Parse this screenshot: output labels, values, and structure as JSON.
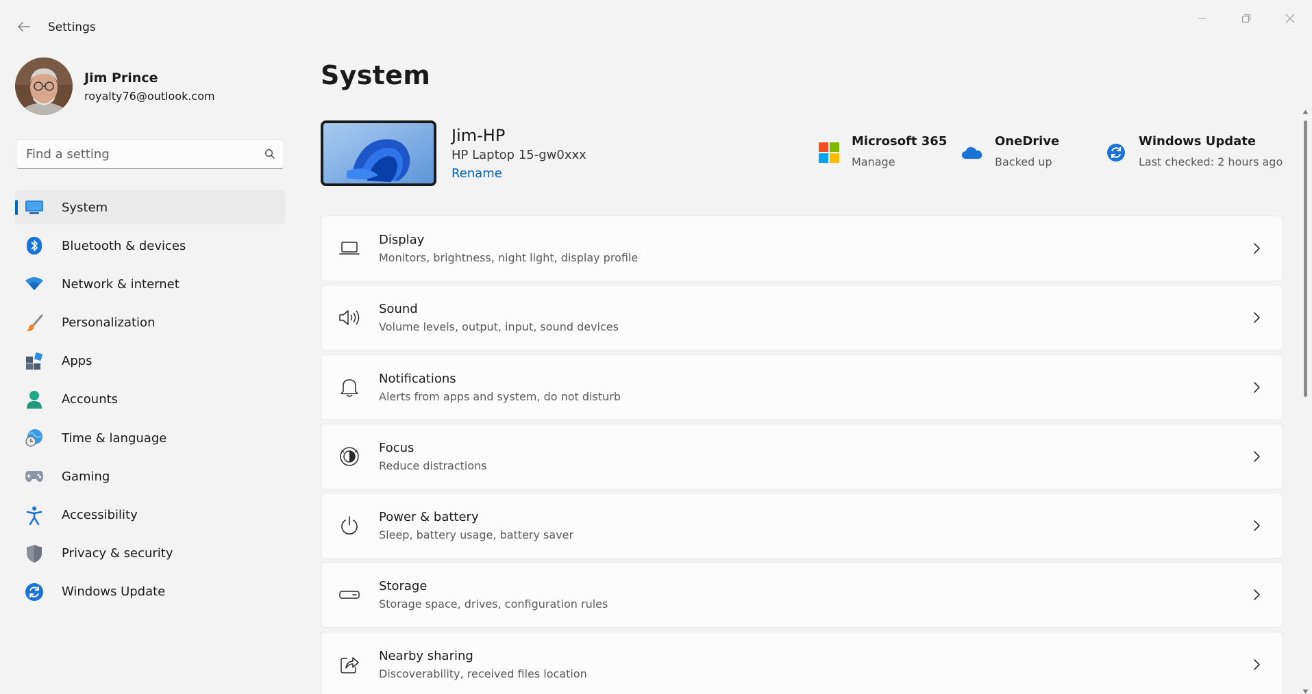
{
  "window": {
    "title": "Settings"
  },
  "profile": {
    "name": "Jim Prince",
    "email": "royalty76@outlook.com"
  },
  "search": {
    "placeholder": "Find a setting"
  },
  "sidebar": {
    "items": [
      {
        "label": "System",
        "icon": "system-icon",
        "active": true
      },
      {
        "label": "Bluetooth & devices",
        "icon": "bluetooth-icon"
      },
      {
        "label": "Network & internet",
        "icon": "wifi-icon"
      },
      {
        "label": "Personalization",
        "icon": "brush-icon"
      },
      {
        "label": "Apps",
        "icon": "apps-icon"
      },
      {
        "label": "Accounts",
        "icon": "account-icon"
      },
      {
        "label": "Time & language",
        "icon": "globe-clock-icon"
      },
      {
        "label": "Gaming",
        "icon": "gamepad-icon"
      },
      {
        "label": "Accessibility",
        "icon": "accessibility-icon"
      },
      {
        "label": "Privacy & security",
        "icon": "shield-icon"
      },
      {
        "label": "Windows Update",
        "icon": "windows-update-icon"
      }
    ]
  },
  "main": {
    "title": "System",
    "device": {
      "name": "Jim-HP",
      "model": "HP Laptop 15-gw0xxx",
      "rename_label": "Rename"
    },
    "quick_links": [
      {
        "title": "Microsoft 365",
        "subtitle": "Manage",
        "icon": "microsoft-logo-icon"
      },
      {
        "title": "OneDrive",
        "subtitle": "Backed up",
        "icon": "onedrive-cloud-icon"
      },
      {
        "title": "Windows Update",
        "subtitle": "Last checked: 2 hours ago",
        "icon": "windows-update-icon"
      }
    ],
    "cards": [
      {
        "title": "Display",
        "description": "Monitors, brightness, night light, display profile",
        "icon": "laptop-icon"
      },
      {
        "title": "Sound",
        "description": "Volume levels, output, input, sound devices",
        "icon": "speaker-icon"
      },
      {
        "title": "Notifications",
        "description": "Alerts from apps and system, do not disturb",
        "icon": "bell-icon"
      },
      {
        "title": "Focus",
        "description": "Reduce distractions",
        "icon": "focus-icon"
      },
      {
        "title": "Power & battery",
        "description": "Sleep, battery usage, battery saver",
        "icon": "power-icon"
      },
      {
        "title": "Storage",
        "description": "Storage space, drives, configuration rules",
        "icon": "storage-icon"
      },
      {
        "title": "Nearby sharing",
        "description": "Discoverability, received files location",
        "icon": "share-icon"
      }
    ]
  },
  "colors": {
    "accent": "#0067c0",
    "link": "#005fb8",
    "background": "#f3f3f3",
    "card": "#fbfbfb"
  }
}
